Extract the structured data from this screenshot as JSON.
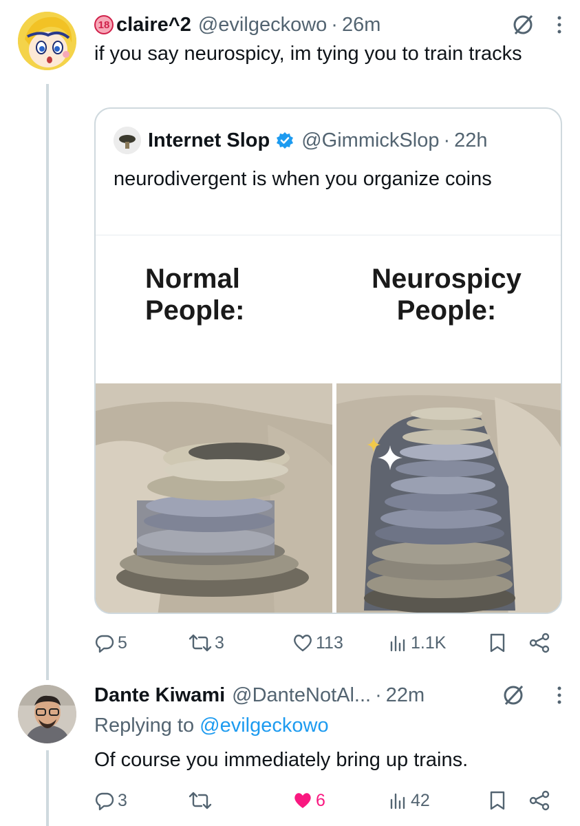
{
  "posts": [
    {
      "author": "claire^2",
      "age_badge": "18",
      "handle": "@evilgeckowo",
      "separator": "·",
      "time": "26m",
      "text": "if you say neurospicy, im tying you to train tracks"
    },
    {
      "author": "Dante Kiwami",
      "handle": "@DanteNotAl...",
      "separator": "·",
      "time": "22m",
      "replying_prefix": "Replying to",
      "replying_to": "@evilgeckowo",
      "text": "Of course you immediately bring up trains."
    }
  ],
  "quote": {
    "author": "Internet Slop",
    "handle": "@GimmickSlop",
    "separator": "·",
    "time": "22h",
    "text": "neurodivergent is when you organize coins",
    "meme": {
      "left_label": [
        "Normal",
        "People:"
      ],
      "right_label": [
        "Neurospicy",
        "People:"
      ]
    }
  },
  "actions": [
    {
      "replies": "5",
      "reposts": "3",
      "likes": "113",
      "views": "1.1K"
    },
    {
      "replies": "3",
      "reposts": "",
      "likes": "6",
      "views": "42"
    }
  ],
  "colors": {
    "text": "#0f1419",
    "muted": "#536471",
    "link": "#1d9bf0",
    "like_active": "#f91880",
    "border": "#cfd9de",
    "verified": "#1d9bf0"
  },
  "icons": [
    "grok-icon",
    "more-icon",
    "reply-icon",
    "repost-icon",
    "like-icon",
    "views-icon",
    "bookmark-icon",
    "share-icon",
    "verified-icon",
    "sparkle-icon"
  ]
}
